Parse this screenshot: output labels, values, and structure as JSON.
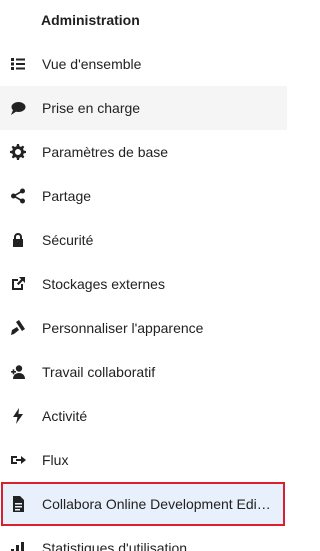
{
  "section": {
    "title": "Administration"
  },
  "menu": {
    "items": [
      {
        "label": "Vue d'ensemble",
        "icon": "list-icon"
      },
      {
        "label": "Prise en charge",
        "icon": "speech-bubble-icon"
      },
      {
        "label": "Paramètres de base",
        "icon": "gear-icon"
      },
      {
        "label": "Partage",
        "icon": "share-icon"
      },
      {
        "label": "Sécurité",
        "icon": "lock-icon"
      },
      {
        "label": "Stockages externes",
        "icon": "external-link-icon"
      },
      {
        "label": "Personnaliser l'apparence",
        "icon": "brush-icon"
      },
      {
        "label": "Travail collaboratif",
        "icon": "users-icon"
      },
      {
        "label": "Activité",
        "icon": "lightning-icon"
      },
      {
        "label": "Flux",
        "icon": "flow-icon"
      },
      {
        "label": "Collabora Online Development Edition",
        "icon": "document-icon"
      },
      {
        "label": "Statistiques d'utilisation",
        "icon": "chart-icon"
      }
    ]
  },
  "colors": {
    "hover_background": "#f5f5f5",
    "selected_background": "#e8f1fb",
    "highlight_outline": "#d8202f",
    "text": "#222222"
  }
}
